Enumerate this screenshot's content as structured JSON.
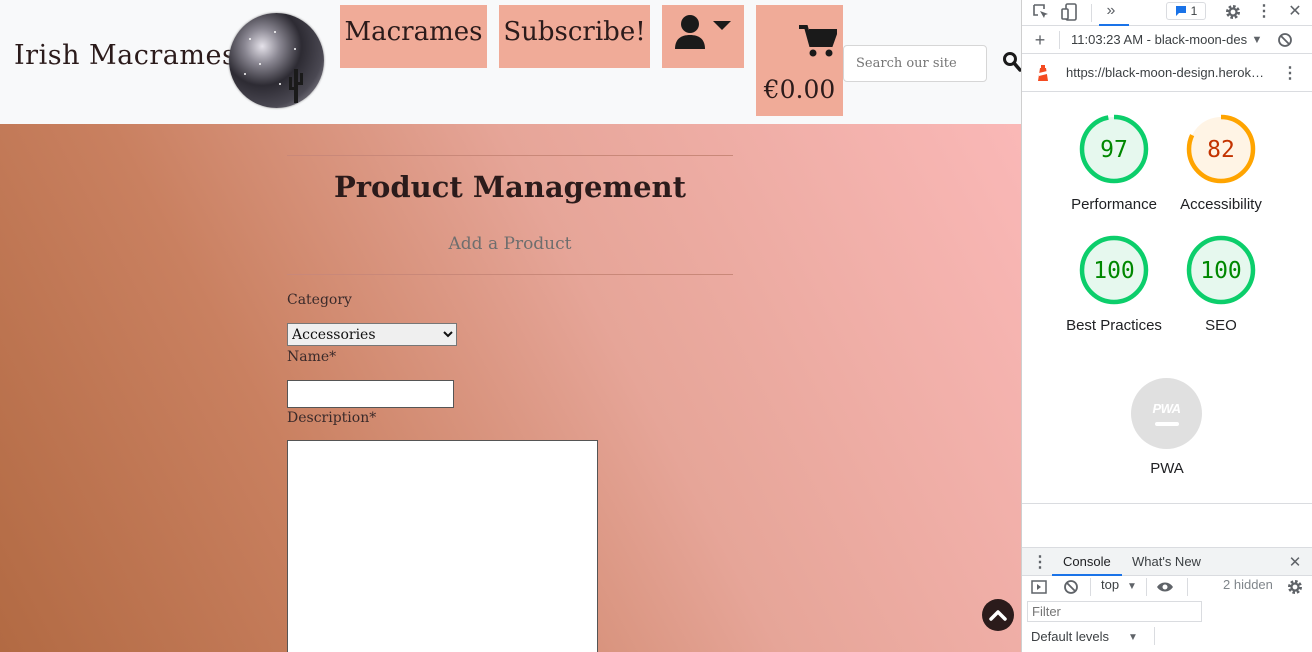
{
  "site": {
    "brand": "Irish Macrames",
    "nav": {
      "macrames": "Macrames",
      "subscribe": "Subscribe!",
      "bag_total": "€0.00"
    },
    "search_placeholder": "Search our site",
    "page": {
      "title": "Product Management",
      "subtitle": "Add a Product",
      "category_label": "Category",
      "category_selected": "Accessories",
      "name_label": "Name*",
      "description_label": "Description*"
    }
  },
  "devtools": {
    "timestamp": "11:03:23 AM - black-moon-des",
    "url": "https://black-moon-design.herok…",
    "issues_count": "1",
    "scores": [
      {
        "label": "Performance",
        "value": "97",
        "score": 97,
        "color": "#0cce6b",
        "text_color": "#008800",
        "bg": "#e6f8ee"
      },
      {
        "label": "Accessibility",
        "value": "82",
        "score": 82,
        "color": "#ffa400",
        "text_color": "#c33300",
        "bg": "#fff4e5"
      },
      {
        "label": "Best Practices",
        "value": "100",
        "score": 100,
        "color": "#0cce6b",
        "text_color": "#008800",
        "bg": "#e6f8ee"
      },
      {
        "label": "SEO",
        "value": "100",
        "score": 100,
        "color": "#0cce6b",
        "text_color": "#008800",
        "bg": "#e6f8ee"
      }
    ],
    "pwa": {
      "badge": "PWA",
      "label": "PWA"
    },
    "drawer": {
      "tab_console": "Console",
      "tab_whats_new": "What's New",
      "context": "top",
      "hidden": "2 hidden",
      "filter_placeholder": "Filter",
      "levels": "Default levels"
    }
  }
}
